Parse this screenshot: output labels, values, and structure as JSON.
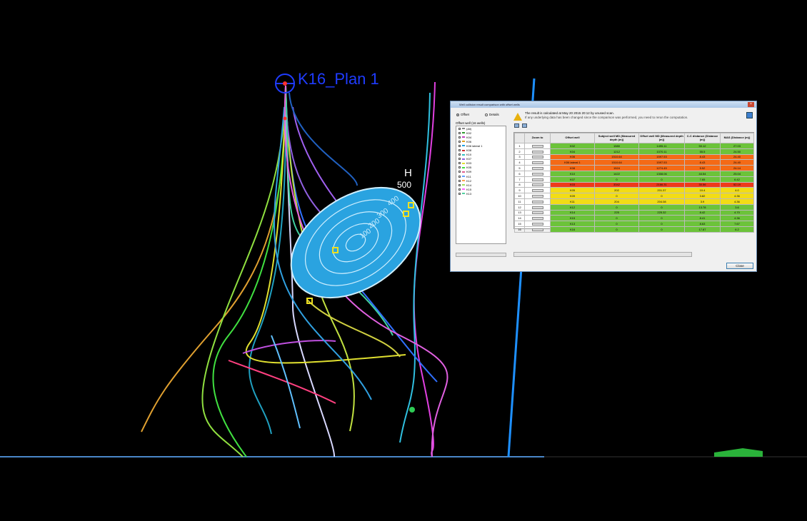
{
  "viewport": {
    "well_label": "K16_Plan 1",
    "scale_letter": "H",
    "scale_value": "500",
    "ellipse_labels": [
      "400",
      "300",
      "200",
      "100"
    ]
  },
  "dialog": {
    "title": "Well collision result comparison with offset wells",
    "close_glyph": "×",
    "radio_offset": "Offset",
    "radio_details": "Details",
    "offset_header": "Offset well (16 wells)",
    "tree_items": [
      "(All)",
      "K02",
      "K04",
      "K06",
      "K06 lateral 1",
      "K08",
      "K10",
      "K07",
      "K03",
      "K05",
      "K09",
      "K11",
      "K12",
      "K14",
      "K15",
      "K13"
    ],
    "tree_colors": [
      "#888888",
      "#2d9b2d",
      "#c040c0",
      "#e0a020",
      "#20a0e0",
      "#d03030",
      "#30c0c0",
      "#9060e0",
      "#e0e030",
      "#40e040",
      "#e06090",
      "#60a0ff",
      "#ffa050",
      "#a0e060",
      "#ff60ff",
      "#50d0a0"
    ],
    "warning_line1": "The result is calculated at May 20 2015 20:12 by unused scan.",
    "warning_line2": "If any underlying data has been changed since the comparison was performed, you need to rerun the computation.",
    "columns": [
      "",
      "Zoom to",
      "Offset well",
      "Subject well MD (Measured depth (m))",
      "Offset well MD (Measured depth (m))",
      "C-C distance (Distance (m))",
      "MAS (Distance (m))"
    ],
    "rows": [
      {
        "n": "1",
        "well": "K02",
        "smd": "1580",
        "omd": "1495.11",
        "cc": "50.12",
        "mas": "27.03",
        "status": "green"
      },
      {
        "n": "2",
        "well": "K04",
        "smd": "1212",
        "omd": "1070.11",
        "cc": "55.5",
        "mas": "24.50",
        "status": "green"
      },
      {
        "n": "3",
        "well": "K06",
        "smd": "1510.64",
        "omd": "1597.53",
        "cc": "8.43",
        "mas": "24.40",
        "status": "orange"
      },
      {
        "n": "4",
        "well": "K06 lateral 1",
        "smd": "1510.64",
        "omd": "1597.53",
        "cc": "8.43",
        "mas": "24.40",
        "status": "orange"
      },
      {
        "n": "5",
        "well": "K08",
        "smd": "1524",
        "omd": "1274.45",
        "cc": "5.52",
        "mas": "24.14",
        "status": "orange"
      },
      {
        "n": "6",
        "well": "K10",
        "smd": "1422",
        "omd": "1308.06",
        "cc": "44.54",
        "mas": "25.04",
        "status": "green"
      },
      {
        "n": "7",
        "well": "K07",
        "smd": "0",
        "omd": "0",
        "cc": "7.65",
        "mas": "6.42",
        "status": "green"
      },
      {
        "n": "8",
        "well": "K03",
        "smd": "3342",
        "omd": "2166.31",
        "cc": "30.56",
        "mas": "52.19",
        "status": "red"
      },
      {
        "n": "9",
        "well": "K05",
        "smd": "202",
        "omd": "201.37",
        "cc": "10.4",
        "mas": "4.0",
        "status": "yellow"
      },
      {
        "n": "10",
        "well": "K09",
        "smd": "0",
        "omd": "0",
        "cc": "3.82",
        "mas": "4.36",
        "status": "yellow"
      },
      {
        "n": "11",
        "well": "K11",
        "smd": "204",
        "omd": "204.08",
        "cc": "3.9",
        "mas": "4.36",
        "status": "yellow"
      },
      {
        "n": "12",
        "well": "K12",
        "smd": "0",
        "omd": "0",
        "cc": "13.78",
        "mas": "3.6",
        "status": "green"
      },
      {
        "n": "13",
        "well": "K14",
        "smd": "225",
        "omd": "225.32",
        "cc": "8.42",
        "mas": "4.70",
        "status": "green"
      },
      {
        "n": "14",
        "well": "K15",
        "smd": "0",
        "omd": "0",
        "cc": "8.41",
        "mas": "4.36",
        "status": "green"
      },
      {
        "n": "15",
        "well": "K13",
        "smd": "0",
        "omd": "0",
        "cc": "8.63",
        "mas": "7.67",
        "status": "green"
      },
      {
        "n": "16",
        "well": "K16",
        "smd": "0",
        "omd": "0",
        "cc": "17.87",
        "mas": "6.2",
        "status": "green"
      }
    ],
    "status_colors": {
      "green": "#6cc33a",
      "orange": "#f46a16",
      "red": "#ee3a1a",
      "yellow": "#f2dc16"
    },
    "close_label": "Close"
  }
}
